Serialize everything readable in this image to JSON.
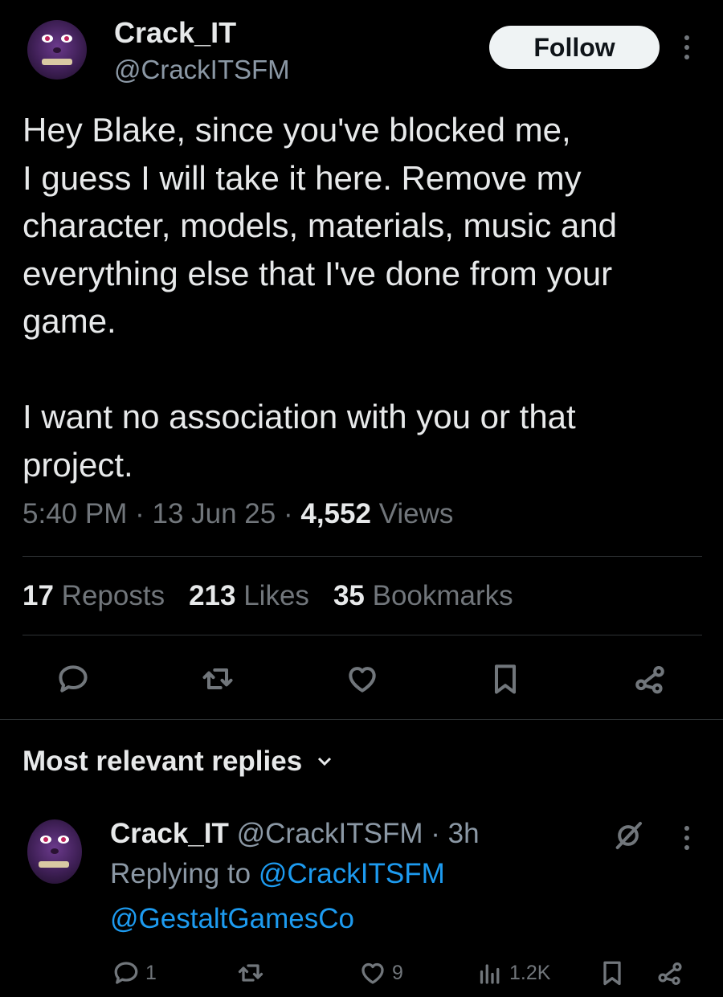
{
  "tweet": {
    "author_name": "Crack_IT",
    "author_handle": "@CrackITSFM",
    "follow_label": "Follow",
    "text_paragraph_1": "Hey Blake, since you've blocked me,\nI guess I will take it here.  Remove my\ncharacter, models, materials, music and\neverything else that I've done from your\ngame.",
    "text_paragraph_2": "I want no association with you or that\nproject.",
    "time": "5:40 PM",
    "date": "13 Jun 25",
    "views_count": "4,552",
    "views_label": "Views",
    "sep": "·"
  },
  "stats": {
    "reposts_count": "17",
    "reposts_label": "Reposts",
    "likes_count": "213",
    "likes_label": "Likes",
    "bookmarks_count": "35",
    "bookmarks_label": "Bookmarks"
  },
  "actions": [
    "reply-icon",
    "repost-icon",
    "like-icon",
    "bookmark-icon",
    "share-icon"
  ],
  "replies_section": {
    "title": "Most relevant replies"
  },
  "reply": {
    "author_name": "Crack_IT",
    "author_handle": "@CrackITSFM",
    "sep": "·",
    "time_ago": "3h",
    "replying_to_label": "Replying to",
    "replying_to_handle": "@CrackITSFM",
    "mention": "@GestaltGamesCo",
    "reply_count": "1",
    "repost_count": "",
    "like_count": "9",
    "views_count": "1.2K"
  },
  "colors": {
    "background": "#000000",
    "text": "#e7e9ea",
    "muted": "#71767b",
    "link": "#1d9bf0",
    "follow_bg": "#eff3f4"
  }
}
